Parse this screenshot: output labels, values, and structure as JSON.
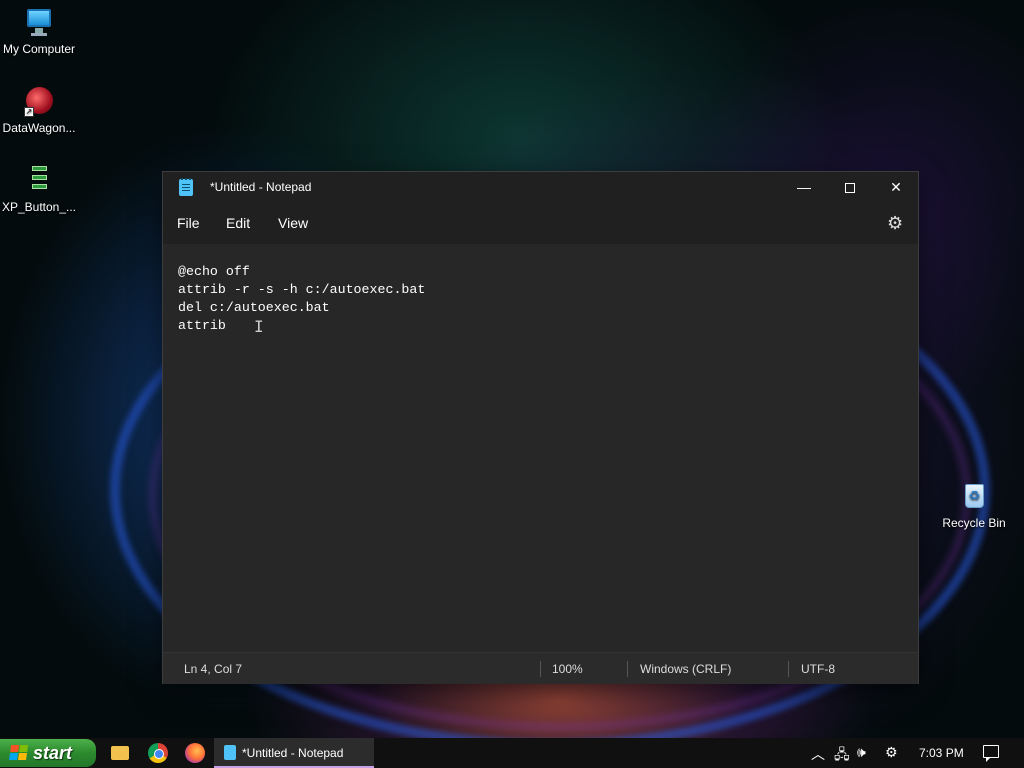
{
  "desktop": {
    "icons": [
      {
        "label": "My Computer",
        "icon": "computer-icon"
      },
      {
        "label": "DataWagon...",
        "icon": "datawagon-icon"
      },
      {
        "label": "XP_Button_...",
        "icon": "xp-buttons-icon"
      },
      {
        "label": "Recycle Bin",
        "icon": "recycle-bin-icon"
      }
    ]
  },
  "notepad": {
    "title": "*Untitled - Notepad",
    "menu": {
      "file": "File",
      "edit": "Edit",
      "view": "View"
    },
    "content_lines": [
      "@echo off",
      "attrib -r -s -h c:/autoexec.bat",
      "del c:/autoexec.bat",
      "attrib "
    ],
    "status": {
      "position": "Ln 4, Col 7",
      "zoom": "100%",
      "line_ending": "Windows (CRLF)",
      "encoding": "UTF-8"
    },
    "colors": {
      "background": "#272727",
      "titlebar": "#202020",
      "text": "#ffffff"
    }
  },
  "taskbar": {
    "start_label": "start",
    "pinned": [
      "file-explorer-icon",
      "chrome-icon",
      "firefox-icon"
    ],
    "active_task": "*Untitled - Notepad",
    "clock": "7:03 PM",
    "colors": {
      "start": "#3a9a3a",
      "active_underline": "#c7a0e8"
    }
  }
}
